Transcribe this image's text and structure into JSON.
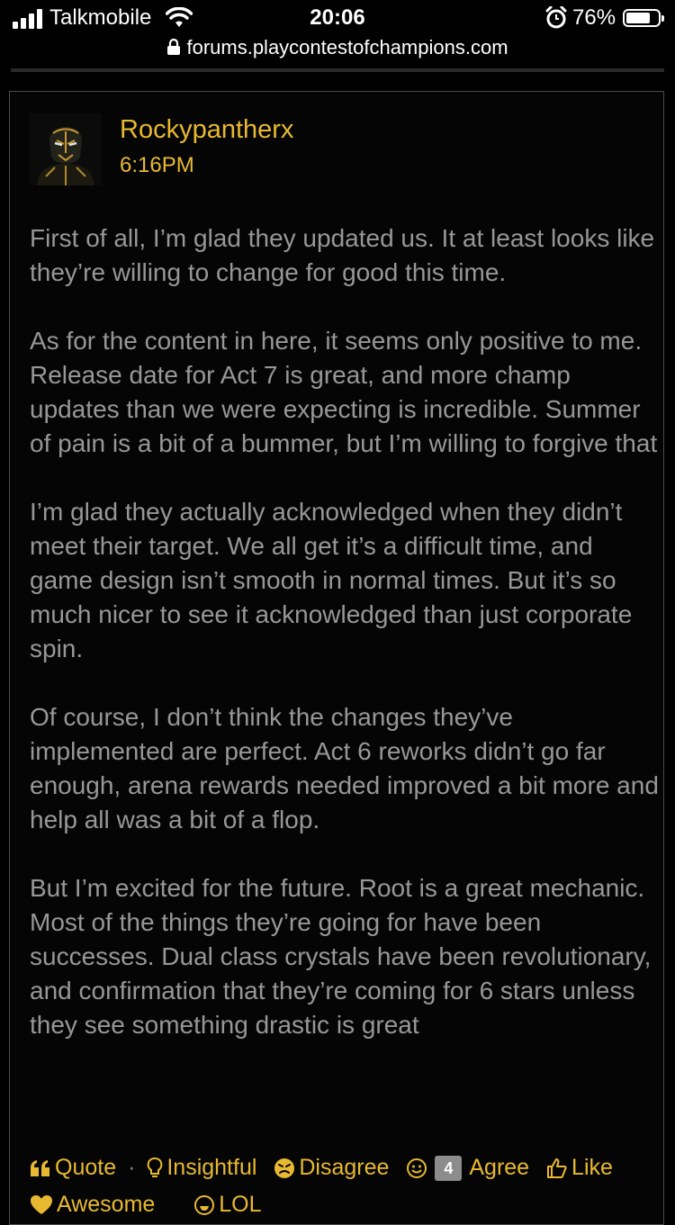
{
  "status_bar": {
    "carrier": "Talkmobile",
    "time": "20:06",
    "battery_percent": "76%",
    "battery_level": 0.76
  },
  "url_bar": {
    "url": "forums.playcontestofchampions.com"
  },
  "post": {
    "author": "Rockypantherx",
    "time": "6:16PM",
    "paragraphs": [
      "First of all, I’m glad they updated us. It at least looks like they’re willing to change for good this time.",
      "As for the content in here, it seems only positive to me. Release date for Act 7 is great, and more champ updates than we were expecting is incredible. Summer of pain is a bit of a bummer, but I’m willing to forgive that",
      "I’m glad they actually acknowledged when they didn’t meet their target. We all get it’s a difficult time, and game design isn’t smooth in normal times. But it’s so much nicer to see it acknowledged than just corporate spin.",
      "Of course, I don’t think the changes they’ve implemented are perfect. Act 6 reworks didn’t go far enough, arena rewards needed improved a bit more and help all was a bit of a flop.",
      "But I’m excited for the future. Root is a great mechanic. Most of the things they’re going for have been successes. Dual class crystals have been revolutionary, and confirmation that they’re coming for 6 stars unless they see something drastic is great"
    ],
    "reactions": {
      "quote": "Quote",
      "separator": "·",
      "insightful": "Insightful",
      "disagree": "Disagree",
      "agree_count": "4",
      "agree": "Agree",
      "like": "Like",
      "cut_row_1": "Awesome",
      "cut_row_2": "LOL"
    },
    "accent_color": "#e8b930"
  }
}
